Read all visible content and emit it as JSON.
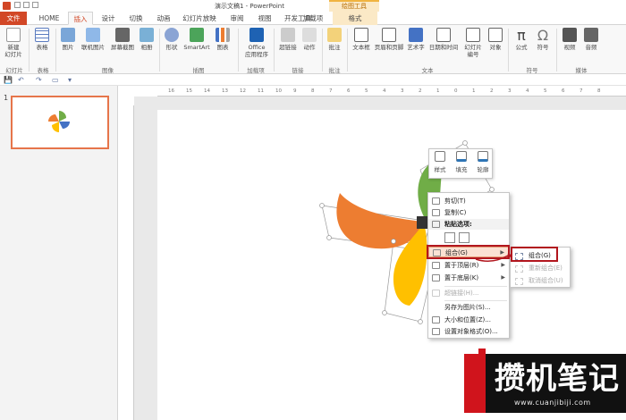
{
  "window": {
    "title": "演示文稿1 - PowerPoint",
    "tool_group": "绘图工具"
  },
  "tabs": [
    {
      "label": "文件"
    },
    {
      "label": "HOME"
    },
    {
      "label": "插入"
    },
    {
      "label": "设计"
    },
    {
      "label": "切换"
    },
    {
      "label": "动画"
    },
    {
      "label": "幻灯片放映"
    },
    {
      "label": "审阅"
    },
    {
      "label": "视图"
    },
    {
      "label": "开发工具"
    },
    {
      "label": "加载项"
    },
    {
      "label": "格式"
    }
  ],
  "ribbon": {
    "buttons": [
      {
        "label": "新建\n幻灯片"
      },
      {
        "label": "表格"
      },
      {
        "label": "图片"
      },
      {
        "label": "联机图片"
      },
      {
        "label": "屏幕截图"
      },
      {
        "label": "相册"
      },
      {
        "label": "形状"
      },
      {
        "label": "SmartArt"
      },
      {
        "label": "图表"
      },
      {
        "label": "Office\n应用程序"
      },
      {
        "label": "超链接"
      },
      {
        "label": "动作"
      },
      {
        "label": "批注"
      },
      {
        "label": "文本框"
      },
      {
        "label": "页眉和页脚"
      },
      {
        "label": "艺术字"
      },
      {
        "label": "日期和时间"
      },
      {
        "label": "幻灯片\n编号"
      },
      {
        "label": "对象"
      },
      {
        "label": "公式"
      },
      {
        "label": "符号"
      },
      {
        "label": "视频"
      },
      {
        "label": "音频"
      }
    ],
    "groups": [
      {
        "label": "幻灯片"
      },
      {
        "label": "表格"
      },
      {
        "label": "图像"
      },
      {
        "label": "插图"
      },
      {
        "label": "加载项"
      },
      {
        "label": "链接"
      },
      {
        "label": "批注"
      },
      {
        "label": "文本"
      },
      {
        "label": "符号"
      },
      {
        "label": "媒体"
      }
    ]
  },
  "slides_pane": {
    "slide_number": "1"
  },
  "ruler": {
    "ticks": [
      "16",
      "15",
      "14",
      "13",
      "12",
      "11",
      "10",
      "9",
      "8",
      "7",
      "6",
      "5",
      "4",
      "3",
      "2",
      "1",
      "0",
      "1",
      "2",
      "3",
      "4",
      "5",
      "6",
      "7",
      "8"
    ]
  },
  "mini_toolbar": {
    "style": "样式",
    "fill": "填充",
    "outline": "轮廓"
  },
  "context_menu": {
    "items": [
      {
        "label": "剪切(T)"
      },
      {
        "label": "复制(C)"
      },
      {
        "label": "粘贴选项:"
      },
      {
        "label": "组合(G)"
      },
      {
        "label": "置于顶层(R)"
      },
      {
        "label": "置于底层(K)"
      },
      {
        "label": "超链接(H)..."
      },
      {
        "label": "另存为图片(S)..."
      },
      {
        "label": "大小和位置(Z)..."
      },
      {
        "label": "设置对象格式(O)..."
      }
    ]
  },
  "submenu": {
    "items": [
      {
        "label": "组合(G)"
      },
      {
        "label": "重新组合(E)"
      },
      {
        "label": "取消组合(U)"
      }
    ]
  },
  "watermark": {
    "text": "攒机笔记",
    "url": "www.cuanjibiji.com"
  },
  "colors": {
    "brand": "#d24726",
    "highlight_box": "#b2161e",
    "petal_orange": "#ed7d31",
    "petal_green": "#70ad47",
    "petal_yellow": "#ffc000",
    "petal_blue": "#4472c4"
  }
}
